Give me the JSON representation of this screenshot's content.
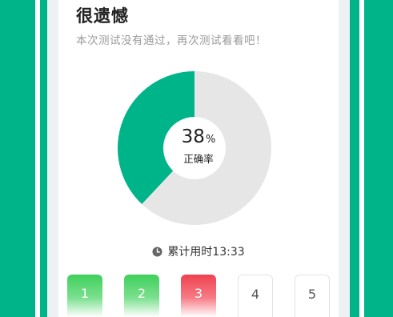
{
  "result": {
    "title": "很遗憾",
    "subtitle": "本次测试没有通过，再次测试看看吧！"
  },
  "score": {
    "percent_value": "38",
    "percent_unit": "%",
    "label": "正确率"
  },
  "time": {
    "icon": "clock-icon",
    "text": "累计用时13:33"
  },
  "questions": [
    {
      "number": "1",
      "status": "correct"
    },
    {
      "number": "2",
      "status": "correct"
    },
    {
      "number": "3",
      "status": "wrong"
    },
    {
      "number": "4",
      "status": "unanswered"
    },
    {
      "number": "5",
      "status": "unanswered"
    }
  ],
  "chart_data": {
    "type": "pie",
    "slices": [
      {
        "value": 38,
        "color": "#00b48a"
      },
      {
        "value": 62,
        "color": "#e6e6e6"
      }
    ]
  },
  "colors": {
    "brand_green": "#00b48a",
    "correct_green": "#3fcf5b",
    "wrong_red": "#f0414f",
    "remaining_gray": "#e6e6e6"
  }
}
